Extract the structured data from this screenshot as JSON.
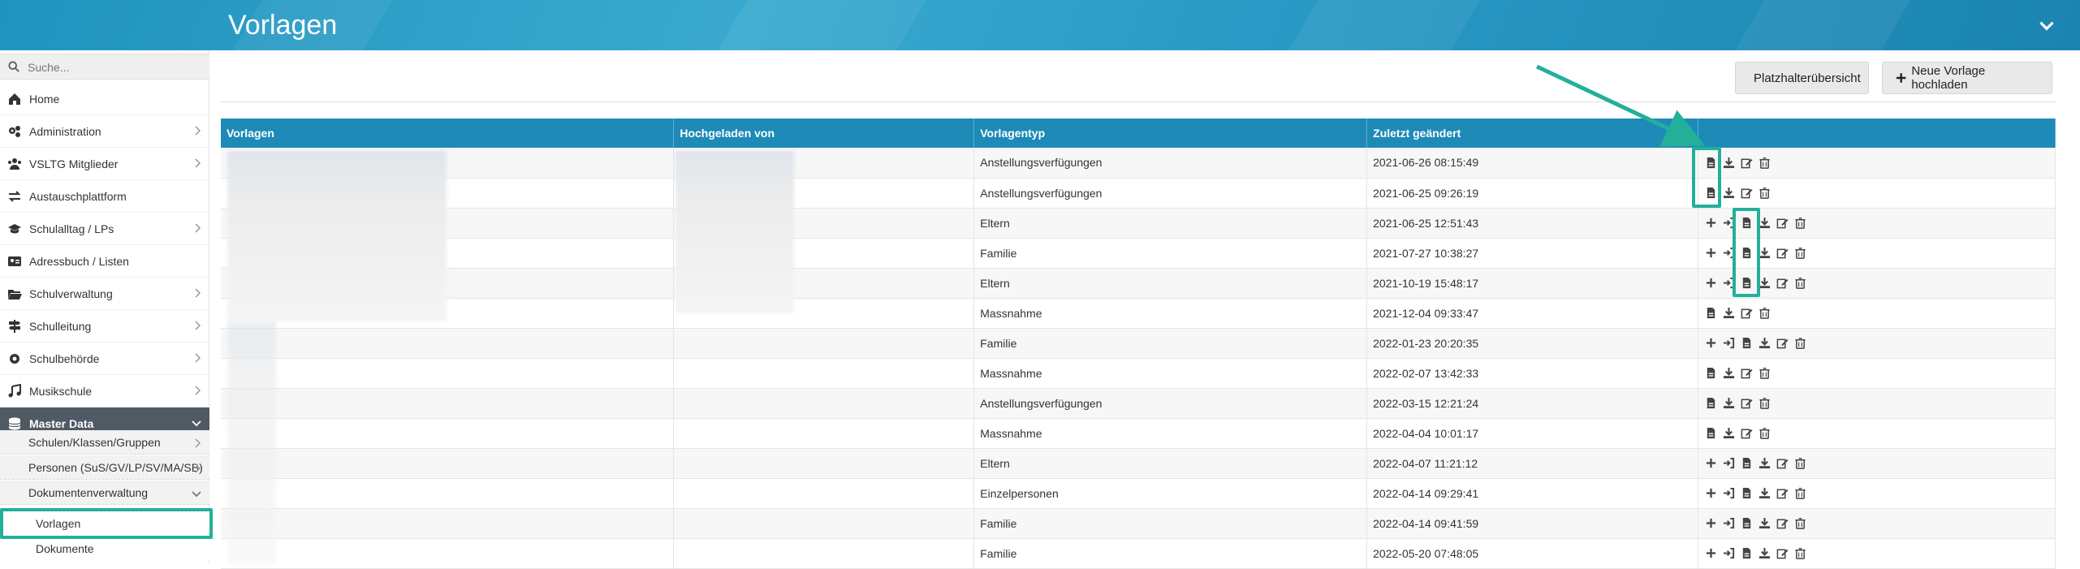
{
  "header": {
    "title": "Vorlagen"
  },
  "search": {
    "placeholder": "Suche..."
  },
  "sidebar": {
    "items": [
      {
        "label": "Home",
        "icon": "home-icon",
        "has_arrow": false
      },
      {
        "label": "Administration",
        "icon": "gears-icon",
        "has_arrow": true
      },
      {
        "label": "VSLTG Mitglieder",
        "icon": "users-icon",
        "has_arrow": true
      },
      {
        "label": "Austauschplattform",
        "icon": "exchange-icon",
        "has_arrow": false
      },
      {
        "label": "Schulalltag / LPs",
        "icon": "graduation-cap-icon",
        "has_arrow": true
      },
      {
        "label": "Adressbuch / Listen",
        "icon": "address-card-icon",
        "has_arrow": false
      },
      {
        "label": "Schulverwaltung",
        "icon": "folder-open-icon",
        "has_arrow": true
      },
      {
        "label": "Schulleitung",
        "icon": "signpost-icon",
        "has_arrow": true
      },
      {
        "label": "Schulbehörde",
        "icon": "cog-icon",
        "has_arrow": true
      },
      {
        "label": "Musikschule",
        "icon": "music-icon",
        "has_arrow": true
      },
      {
        "label": "Master Data",
        "icon": "database-icon",
        "has_arrow": true
      }
    ],
    "master_data_sub": [
      {
        "label": "Schulen/Klassen/Gruppen"
      },
      {
        "label": "Personen (SuS/GV/LP/SV/MA/SB)"
      },
      {
        "label": "Dokumentenverwaltung"
      }
    ],
    "dokumenten_sub": [
      {
        "label": "Vorlagen"
      },
      {
        "label": "Dokumente"
      }
    ]
  },
  "toolbar": {
    "placeholder_button": "Platzhalterübersicht",
    "upload_button": "Neue Vorlage hochladen"
  },
  "table": {
    "headers": [
      "Vorlagen",
      "Hochgeladen von",
      "Vorlagentyp",
      "Zuletzt geändert",
      ""
    ],
    "rows": [
      {
        "type": "Anstellungsverfügungen",
        "changed": "2021-06-26 08:15:49",
        "actions": "short"
      },
      {
        "type": "Anstellungsverfügungen",
        "changed": "2021-06-25 09:26:19",
        "actions": "short"
      },
      {
        "type": "Eltern",
        "changed": "2021-06-25 12:51:43",
        "actions": "long"
      },
      {
        "type": "Familie",
        "changed": "2021-07-27 10:38:27",
        "actions": "long"
      },
      {
        "type": "Eltern",
        "changed": "2021-10-19 15:48:17",
        "actions": "long"
      },
      {
        "type": "Massnahme",
        "changed": "2021-12-04 09:33:47",
        "actions": "short"
      },
      {
        "type": "Familie",
        "changed": "2022-01-23 20:20:35",
        "actions": "long"
      },
      {
        "type": "Massnahme",
        "changed": "2022-02-07 13:42:33",
        "actions": "short"
      },
      {
        "type": "Anstellungsverfügungen",
        "changed": "2022-03-15 12:21:24",
        "actions": "short"
      },
      {
        "type": "Massnahme",
        "changed": "2022-04-04 10:01:17",
        "actions": "short"
      },
      {
        "type": "Eltern",
        "changed": "2022-04-07 11:21:12",
        "actions": "long"
      },
      {
        "type": "Einzelpersonen",
        "changed": "2022-04-14 09:29:41",
        "actions": "long"
      },
      {
        "type": "Familie",
        "changed": "2022-04-14 09:41:59",
        "actions": "long"
      },
      {
        "type": "Familie",
        "changed": "2022-05-20 07:48:05",
        "actions": "long"
      }
    ]
  },
  "colors": {
    "header_blue": "#1d8ab8",
    "highlight": "#22b09b",
    "active_nav": "#4f5a65"
  }
}
